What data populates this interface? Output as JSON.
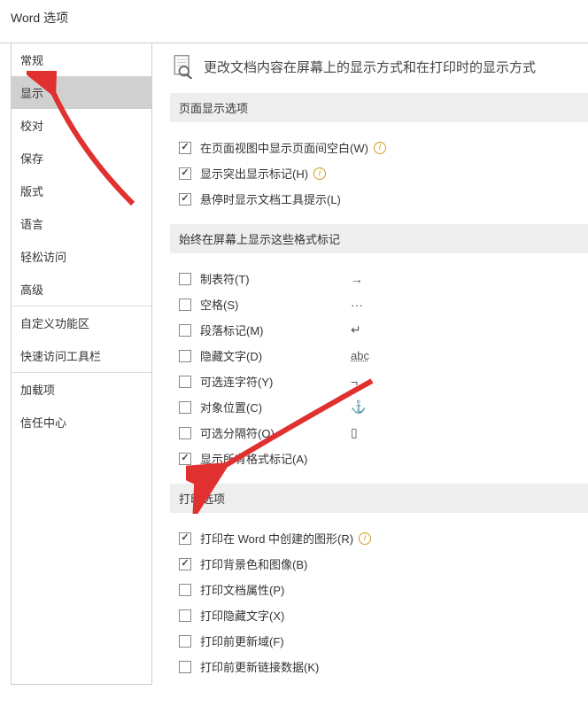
{
  "window_title": "Word 选项",
  "sidebar": {
    "items": [
      {
        "label": "常规"
      },
      {
        "label": "显示",
        "selected": true
      },
      {
        "label": "校对"
      },
      {
        "label": "保存"
      },
      {
        "label": "版式"
      },
      {
        "label": "语言"
      },
      {
        "label": "轻松访问"
      },
      {
        "label": "高级"
      }
    ],
    "items2": [
      {
        "label": "自定义功能区"
      },
      {
        "label": "快速访问工具栏"
      }
    ],
    "items3": [
      {
        "label": "加载项"
      },
      {
        "label": "信任中心"
      }
    ]
  },
  "header": {
    "title": "更改文档内容在屏幕上的显示方式和在打印时的显示方式"
  },
  "sections": {
    "page_display": {
      "title": "页面显示选项",
      "opts": [
        {
          "label": "在页面视图中显示页面间空白(W)",
          "checked": true,
          "info": true
        },
        {
          "label": "显示突出显示标记(H)",
          "checked": true,
          "info": true
        },
        {
          "label": "悬停时显示文档工具提示(L)",
          "checked": true,
          "info": false
        }
      ]
    },
    "format_marks": {
      "title": "始终在屏幕上显示这些格式标记",
      "opts": [
        {
          "label": "制表符(T)",
          "checked": false,
          "sym": "→"
        },
        {
          "label": "空格(S)",
          "checked": false,
          "sym": "···"
        },
        {
          "label": "段落标记(M)",
          "checked": false,
          "sym": "↵"
        },
        {
          "label": "隐藏文字(D)",
          "checked": false,
          "sym": "abc"
        },
        {
          "label": "可选连字符(Y)",
          "checked": false,
          "sym": "¬"
        },
        {
          "label": "对象位置(C)",
          "checked": false,
          "sym": "⚓"
        },
        {
          "label": "可选分隔符(O)",
          "checked": false,
          "sym": "▯"
        },
        {
          "label": "显示所有格式标记(A)",
          "checked": true,
          "sym": ""
        }
      ]
    },
    "print": {
      "title": "打印选项",
      "opts": [
        {
          "label": "打印在 Word 中创建的图形(R)",
          "checked": true,
          "info": true
        },
        {
          "label": "打印背景色和图像(B)",
          "checked": true,
          "info": false
        },
        {
          "label": "打印文档属性(P)",
          "checked": false,
          "info": false
        },
        {
          "label": "打印隐藏文字(X)",
          "checked": false,
          "info": false
        },
        {
          "label": "打印前更新域(F)",
          "checked": false,
          "info": false
        },
        {
          "label": "打印前更新链接数据(K)",
          "checked": false,
          "info": false
        }
      ]
    }
  }
}
